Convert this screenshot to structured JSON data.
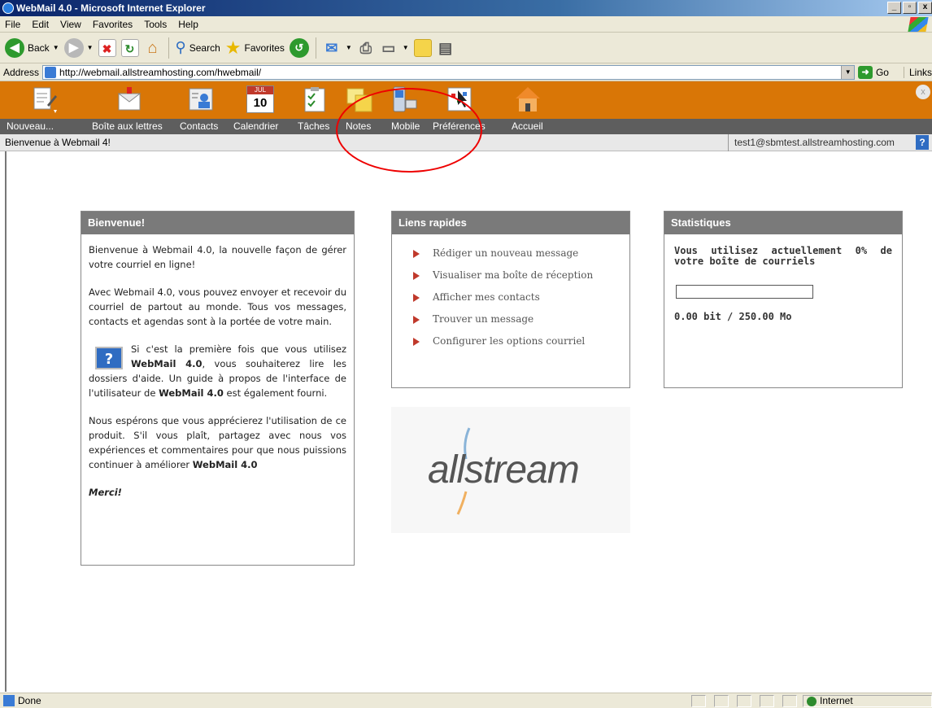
{
  "window": {
    "title": "WebMail 4.0 - Microsoft Internet Explorer",
    "buttons": [
      "_",
      "8",
      "x"
    ]
  },
  "menu": [
    "File",
    "Edit",
    "View",
    "Favorites",
    "Tools",
    "Help"
  ],
  "toolbar": {
    "back": "Back",
    "search": "Search",
    "favorites": "Favorites"
  },
  "address": {
    "label": "Address",
    "url": "http://webmail.allstreamhosting.com/hwebmail/",
    "go": "Go",
    "links": "Links"
  },
  "appnav": {
    "items": [
      "Nouveau...",
      "Boîte aux lettres",
      "Contacts",
      "Calendrier",
      "Tâches",
      "Notes",
      "Mobile",
      "Préférences",
      "Accueil"
    ],
    "calendar_month": "JUL",
    "calendar_day": "10"
  },
  "status": {
    "welcome": "Bienvenue à Webmail 4!",
    "user": "test1@sbmtest.allstreamhosting.com",
    "help": "?"
  },
  "bienvenue": {
    "title": "Bienvenue!",
    "p1": "Bienvenue à Webmail 4.0, la nouvelle façon de gérer votre courriel en ligne!",
    "p2": "Avec Webmail 4.0, vous pouvez envoyer et recevoir du courriel de partout au monde. Tous vos messages, contacts et agendas sont à la portée de votre main.",
    "p3a": "Si c'est la première fois que vous utilisez ",
    "p3b": "WebMail 4.0",
    "p3c": ", vous souhaiterez lire les dossiers d'aide. Un guide à propos de l'interface de l'utilisateur de ",
    "p3d": "WebMail 4.0",
    "p3e": " est également fourni.",
    "p4a": "Nous espérons que vous apprécierez l'utilisation de ce produit. S'il vous plaît, partagez avec nous vos expériences et commentaires pour que nous puissions continuer à améliorer ",
    "p4b": "WebMail 4.0",
    "merci": "Merci!"
  },
  "liens": {
    "title": "Liens rapides",
    "items": [
      "Rédiger un nouveau message",
      "Visualiser ma boîte de réception",
      "Afficher mes contacts",
      "Trouver un message",
      "Configurer les options courriel"
    ]
  },
  "stats": {
    "title": "Statistiques",
    "usage": "Vous utilisez actuellement 0% de votre boîte de courriels",
    "quota_percent": 0,
    "amount": "0.00 bit / 250.00 Mo"
  },
  "logo": {
    "text": "allstream"
  },
  "statusbar": {
    "left": "Done",
    "zone": "Internet"
  }
}
